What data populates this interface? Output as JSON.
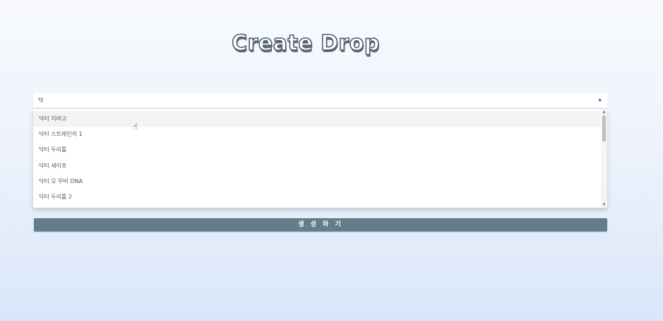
{
  "page": {
    "title": "Create Drop"
  },
  "select": {
    "value": "닥",
    "arrow_icon": "caret-up-icon",
    "options": [
      "닥터 지바고",
      "닥터 스트레인지 1",
      "닥터 두리틀",
      "닥터 세이프",
      "닥터 오 무비 DNA",
      "닥터 두리틀 2"
    ]
  },
  "submit": {
    "label": "생 성 하 기"
  },
  "colors": {
    "button": "#647d8b",
    "accent": "#3b6fb6"
  }
}
